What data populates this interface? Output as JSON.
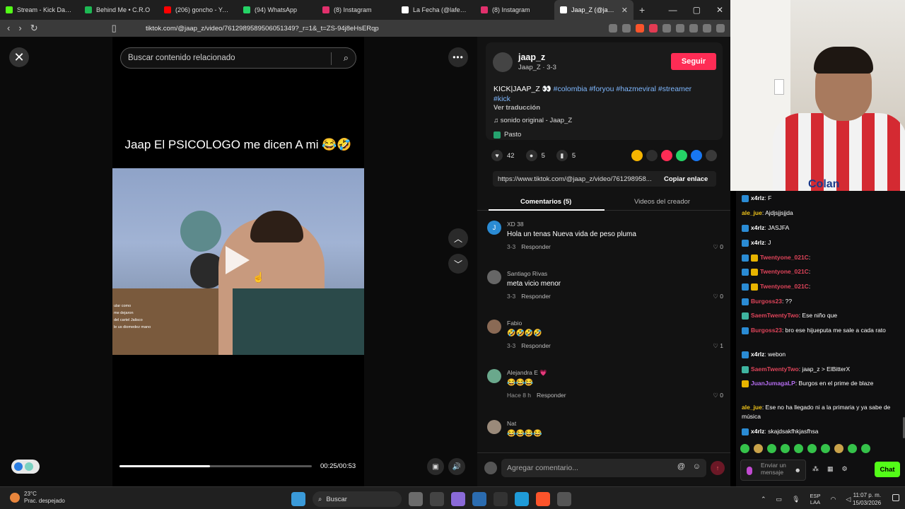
{
  "browser": {
    "tabs": [
      {
        "label": "Stream - Kick Dashbo",
        "color": "#53fc18"
      },
      {
        "label": "Behind Me • C.R.O",
        "color": "#1db954"
      },
      {
        "label": "(206) goncho - YouTu",
        "color": "#ff0000"
      },
      {
        "label": "(94) WhatsApp",
        "color": "#25d366"
      },
      {
        "label": "(8) Instagram",
        "color": "#e1306c"
      },
      {
        "label": "La Fecha (@lafechad",
        "color": "#ffffff"
      },
      {
        "label": "(8) Instagram",
        "color": "#e1306c"
      },
      {
        "label": "Jaap_Z (@jaap_z",
        "color": "#ffffff",
        "active": true
      }
    ],
    "new_tab": "+",
    "url": "tiktok.com/@jaap_z/video/7612989589506051349?_r=1&_t=ZS-94j8eHsERqp"
  },
  "player": {
    "search_placeholder": "Buscar contenido relacionado",
    "video_title": "Jaap El PSICOLOGO me dicen A mi 😂🤣",
    "overlay_lines": [
      "ular como",
      "me dejaron",
      "del cartel Jalisco",
      "le us diomedez mano"
    ],
    "time": "00:25/00:53",
    "progress_fraction": 0.47
  },
  "info": {
    "author_name": "jaap_z",
    "author_sub": "Jaap_Z · 3-3",
    "follow_label": "Seguir",
    "caption_text": "KICK|JAAP_Z 👀 ",
    "caption_tags": "#colombia #foryou #hazmeviral #streamer #kick",
    "translate_label": "Ver traducción",
    "sound_label": "♫  sonido original - Jaap_Z",
    "location_label": "Pasto",
    "likes": "42",
    "comments_count": "5",
    "saves": "5",
    "link_text": "https://www.tiktok.com/@jaap_z/video/761298958...",
    "copy_link_label": "Copiar enlace",
    "tab_comments": "Comentarios (5)",
    "tab_creator": "Videos del creador",
    "comment_placeholder": "Agregar comentario...",
    "comment_list": [
      {
        "initial": "J",
        "name": "XD 38",
        "text": "Hola un tenas Nueva vida de peso pluma",
        "meta": "3-3",
        "reply": "Responder",
        "likes": "0",
        "avatar_color": "#2a8bd4"
      },
      {
        "initial": "",
        "name": "Santiago Rivas",
        "text": "meta vicio menor",
        "meta": "3-3",
        "reply": "Responder",
        "likes": "0",
        "avatar_color": "#666666"
      },
      {
        "initial": "",
        "name": "Fabio",
        "text": "🤣🤣🤣🤣",
        "meta": "3-3",
        "reply": "Responder",
        "likes": "1",
        "avatar_color": "#8a6a55"
      },
      {
        "initial": "",
        "name": "Alejandra E 💗",
        "text": "😂😂😂",
        "meta": "Hace 8 h",
        "reply": "Responder",
        "likes": "0",
        "avatar_color": "#6aa88c"
      },
      {
        "initial": "",
        "name": "Nat",
        "text": "😂😂😂😂",
        "meta": "",
        "reply": "",
        "likes": "",
        "avatar_color": "#9a8a7a"
      }
    ]
  },
  "webcam": {
    "jersey_text": "Colan"
  },
  "chat": {
    "messages": [
      {
        "user": "x4rlz",
        "text": ": F",
        "color": "#ffffff",
        "badges": [
          "#2a8bd4"
        ]
      },
      {
        "user": "ale_jue",
        "text": ": Ajdjsjjsjjda",
        "color": "#f0c419",
        "badges": []
      },
      {
        "user": "x4rlz",
        "text": ": JASJFA",
        "color": "#ffffff",
        "badges": [
          "#2a8bd4"
        ]
      },
      {
        "user": "x4rlz",
        "text": ": J",
        "color": "#ffffff",
        "badges": [
          "#2a8bd4"
        ]
      },
      {
        "user": "Twentyone_021C",
        "text": ":",
        "color": "#e0445a",
        "badges": [
          "#2a8bd4",
          "#e8b400"
        ]
      },
      {
        "user": "Twentyone_021C",
        "text": ":",
        "color": "#e0445a",
        "badges": [
          "#2a8bd4",
          "#e8b400"
        ]
      },
      {
        "user": "Twentyone_021C",
        "text": ":",
        "color": "#e0445a",
        "badges": [
          "#2a8bd4",
          "#e8b400"
        ]
      },
      {
        "user": "Burgoss23",
        "text": ": ??",
        "color": "#e0445a",
        "badges": [
          "#2a8bd4"
        ]
      },
      {
        "user": "SaemTwentyTwo",
        "text": ": Ese niño que",
        "color": "#e0445a",
        "badges": [
          "#3fb4a0"
        ]
      },
      {
        "user": "Burgoss23",
        "text": ": bro ese hijueputa me sale a cada rato",
        "color": "#e0445a",
        "badges": [
          "#2a8bd4"
        ]
      },
      {
        "user": "x4rlz",
        "text": ": webon",
        "color": "#ffffff",
        "badges": [
          "#2a8bd4"
        ]
      },
      {
        "user": "SaemTwentyTwo",
        "text": ": jaap_z > ElBitterX",
        "color": "#e0445a",
        "badges": [
          "#3fb4a0"
        ]
      },
      {
        "user": "JuanJumagaLP",
        "text": ": Burgos en el prime de blaze",
        "color": "#b46cf0",
        "badges": [
          "#e8b400"
        ]
      },
      {
        "user": "ale_jue",
        "text": ": Ese no ha llegado ni a la primaria y ya sabe de música",
        "color": "#f0c419",
        "badges": []
      },
      {
        "user": "x4rlz",
        "text": ": skajdsakfhkjasfhsa",
        "color": "#ffffff",
        "badges": [
          "#2a8bd4"
        ]
      }
    ],
    "input_placeholder": "Enviar un mensaje",
    "send_label": "Chat"
  },
  "taskbar": {
    "temp": "23°C",
    "weather": "Prac. despejado",
    "search_label": "Buscar",
    "lang_top": "ESP",
    "lang_bottom": "LAA",
    "time": "11:07 p. m.",
    "date": "15/03/2026"
  }
}
